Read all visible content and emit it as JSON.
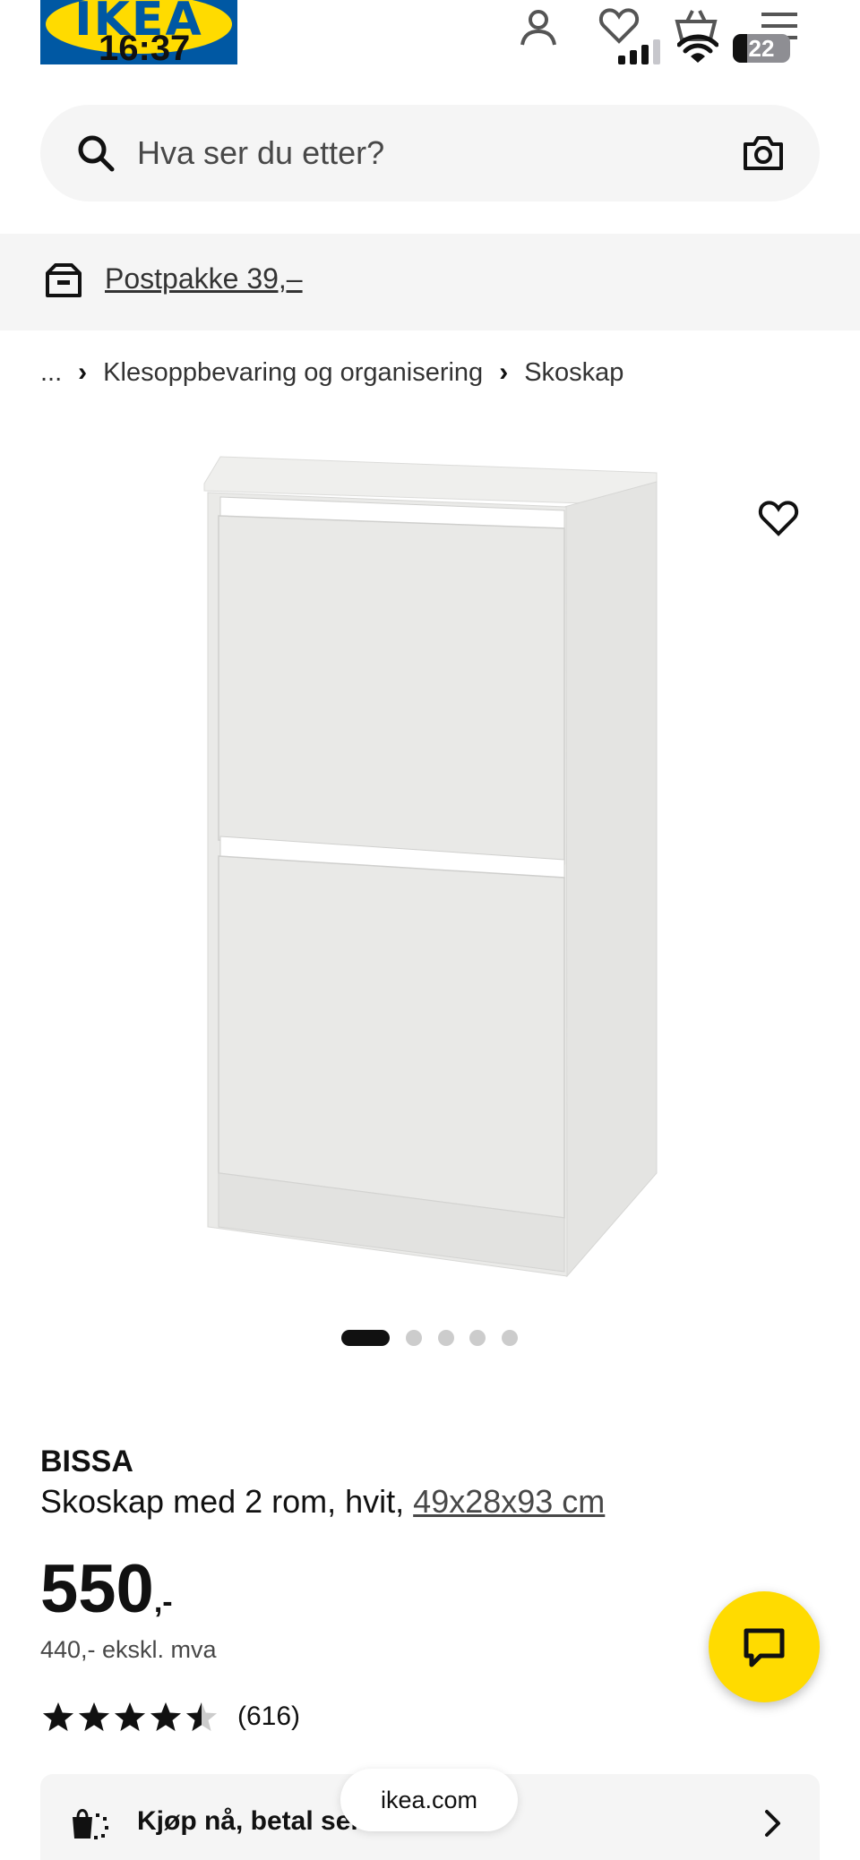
{
  "header": {
    "logo_text": "IKEA",
    "time": "16:37",
    "battery_level": "22",
    "icons": [
      "person-icon",
      "heart-icon",
      "bag-icon",
      "menu-icon"
    ]
  },
  "search": {
    "placeholder": "Hva ser du etter?"
  },
  "shipping_banner": {
    "label": "Postpakke 39,–"
  },
  "breadcrumb": {
    "ellipsis": "...",
    "items": [
      "Klesoppbevaring og organisering",
      "Skoskap"
    ]
  },
  "gallery": {
    "total_images": 5,
    "active_index": 1
  },
  "product": {
    "name": "BISSA",
    "description": "Skoskap med 2 rom, hvit, ",
    "dimensions": "49x28x93 cm",
    "price": "550",
    "price_suffix": ",-",
    "price_ex_vat": "440,- ekskl. mva",
    "rating_value": 4.5,
    "rating_count": "(616)"
  },
  "buy_now": {
    "label": "Kjøp nå, betal senere"
  },
  "browser": {
    "url": "ikea.com"
  },
  "colors": {
    "ikea_blue": "#0058a3",
    "ikea_yellow": "#ffdb00",
    "light_bg": "#f5f5f5"
  }
}
